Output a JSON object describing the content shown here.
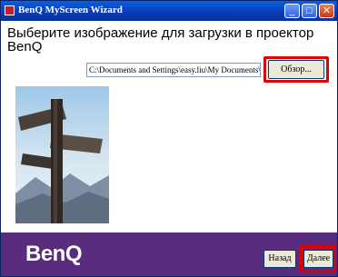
{
  "window": {
    "title": "BenQ MyScreen Wizard",
    "controls": {
      "minimize": "_",
      "maximize": "□",
      "close": "✕"
    }
  },
  "main": {
    "instruction": "Выберите изображение для загрузки в проектор BenQ",
    "path_value": "C:\\Documents and Settings\\easy.liu\\My Documents\\",
    "browse_label": "Обзор..."
  },
  "footer": {
    "brand": "BenQ",
    "back_label": "Назад",
    "next_label": "Далее"
  },
  "colors": {
    "title_bar": "#0A3DBA",
    "footer_bg": "#5A2C7E",
    "highlight": "#E00000"
  }
}
